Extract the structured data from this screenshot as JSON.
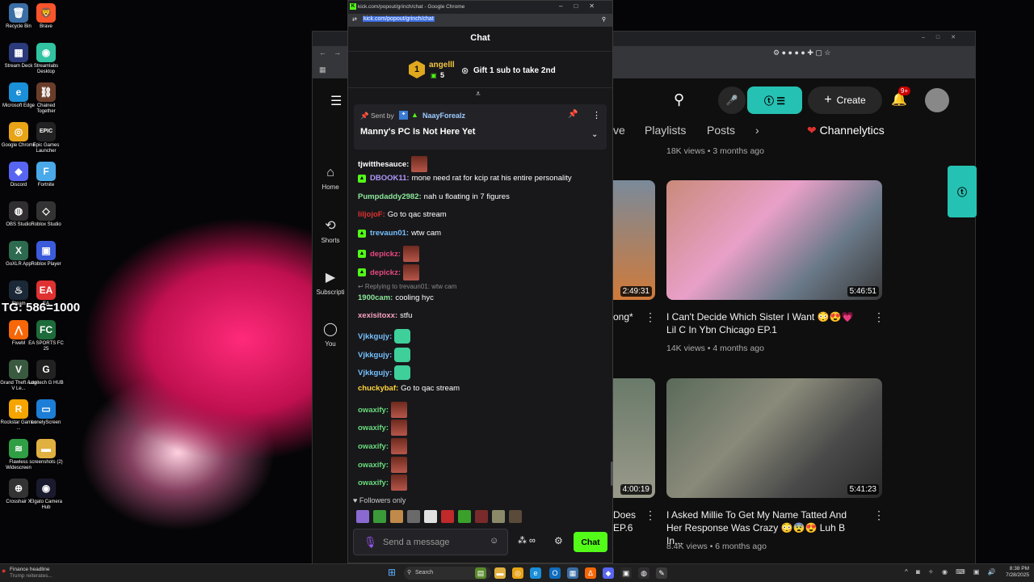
{
  "desktop": {
    "icons": [
      {
        "label": "Recycle Bin",
        "glyph": "🗑",
        "color": "#3a6ea5"
      },
      {
        "label": "Brave",
        "glyph": "🦁",
        "color": "#fb542b"
      },
      {
        "label": "Stream Deck",
        "glyph": "▦",
        "color": "#2b3a7a"
      },
      {
        "label": "Streamlabs Desktop",
        "glyph": "◉",
        "color": "#31c3a2"
      },
      {
        "label": "Microsoft Edge",
        "glyph": "e",
        "color": "#1b8fd8"
      },
      {
        "label": "Chained Together",
        "glyph": "⛓",
        "color": "#6a3d2a"
      },
      {
        "label": "Google Chrome",
        "glyph": "◎",
        "color": "#e8a317"
      },
      {
        "label": "Epic Games Launcher",
        "glyph": "EPIC",
        "color": "#222222"
      },
      {
        "label": "Discord",
        "glyph": "◆",
        "color": "#5865f2"
      },
      {
        "label": "Fortnite",
        "glyph": "F",
        "color": "#4aa9e8"
      },
      {
        "label": "OBS Studio",
        "glyph": "◍",
        "color": "#302e31"
      },
      {
        "label": "Roblox Studio",
        "glyph": "◇",
        "color": "#333333"
      },
      {
        "label": "GoXLR App",
        "glyph": "X",
        "color": "#2d6a4f"
      },
      {
        "label": "Roblox Player",
        "glyph": "▣",
        "color": "#3b5bdb"
      },
      {
        "label": "Steam",
        "glyph": "♨",
        "color": "#1b2838"
      },
      {
        "label": "EA",
        "glyph": "EA",
        "color": "#e03131"
      },
      {
        "label": "FiveM",
        "glyph": "⋀",
        "color": "#f76707"
      },
      {
        "label": "EA SPORTS FC 25",
        "glyph": "FC",
        "color": "#1d6b3a"
      },
      {
        "label": "Grand Theft Auto V Le...",
        "glyph": "V",
        "color": "#3a5a40"
      },
      {
        "label": "Logitech G HUB",
        "glyph": "G",
        "color": "#222222"
      },
      {
        "label": "Rockstar Games ...",
        "glyph": "R",
        "color": "#f5a400"
      },
      {
        "label": "LonelyScreen",
        "glyph": "▭",
        "color": "#1c7ed6"
      },
      {
        "label": "Flawless Widescreen",
        "glyph": "≋",
        "color": "#2f9e44"
      },
      {
        "label": "screenshots (2)",
        "glyph": "▬",
        "color": "#e0b040"
      },
      {
        "label": "Crosshair X",
        "glyph": "⊕",
        "color": "#333333"
      },
      {
        "label": "Elgato Camera Hub",
        "glyph": "◉",
        "color": "#1a1a2e"
      }
    ],
    "overlay_text": "TG: 586=1000"
  },
  "youtube_window": {
    "sidebar": [
      {
        "label": "Home",
        "glyph": "⌂"
      },
      {
        "label": "Shorts",
        "glyph": "⟲"
      },
      {
        "label": "Subscripti",
        "glyph": "▶"
      },
      {
        "label": "You",
        "glyph": "◯"
      }
    ],
    "create_label": "Create",
    "notif_count": "9+",
    "tabs": [
      "ve",
      "Playlists",
      "Posts",
      "›",
      "Channelytics"
    ],
    "top_meta": "18K views • 3 months ago",
    "videos": [
      {
        "title": "I Can't Decide Which Sister I Want 😳😍💗 Lil C In Ybn Chicago EP.1",
        "meta": "14K views • 4 months ago",
        "duration": "5:46:51"
      },
      {
        "title": "I Asked Millie To Get My Name Tatted And Her Response Was Crazy 😳😨😍 Luh B In...",
        "meta": "8.4K views • 6 months ago",
        "duration": "5:41:23"
      }
    ],
    "left_partial": [
      {
        "duration": "2:49:31",
        "title": "ong*"
      },
      {
        "duration": "4:00:19",
        "title": "Does EP.6"
      }
    ]
  },
  "kick": {
    "window_title": "kick.com/popout/grinch/chat - Google Chrome",
    "url": "kick.com/popout/grinch/chat",
    "chat_title": "Chat",
    "gift": {
      "rank": "1",
      "user": "angelll",
      "count": "5",
      "cta": "Gift 1 sub to take 2nd"
    },
    "pinned": {
      "sent_by": "Sent by",
      "user": "NaayForealz",
      "message": "Manny's PC Is Not Here Yet"
    },
    "messages": [
      {
        "user": "tjwitthesauce:",
        "color": "#ffffff",
        "text": "",
        "emote": "face",
        "badge": false
      },
      {
        "user": "DBOOK11:",
        "color": "#b197fc",
        "text": "mone need rat for kcip rat his entire personality",
        "emote": "",
        "badge": true
      },
      {
        "user": "Pumpdaddy2982:",
        "color": "#8ce99a",
        "text": "nah u floating in 7 figures",
        "emote": "",
        "badge": false
      },
      {
        "user": "liljojoF:",
        "color": "#e03131",
        "text": "Go to qac stream",
        "emote": "",
        "badge": false
      },
      {
        "user": "trevaun01:",
        "color": "#74c0fc",
        "text": "wtw cam",
        "emote": "",
        "badge": true
      },
      {
        "user": "depickz:",
        "color": "#e64980",
        "text": "",
        "emote": "face",
        "badge": true
      },
      {
        "user": "depickz:",
        "color": "#e64980",
        "text": "",
        "emote": "face",
        "badge": true
      },
      {
        "user": "1900cam:",
        "color": "#8ce99a",
        "text": "cooling hyc",
        "emote": "",
        "badge": false
      },
      {
        "user": "xexisitoxx:",
        "color": "#faa2c1",
        "text": "stfu",
        "emote": "",
        "badge": false
      },
      {
        "user": "Vjkkgujy:",
        "color": "#74c0fc",
        "text": "",
        "emote": "green",
        "badge": false
      },
      {
        "user": "Vjkkgujy:",
        "color": "#74c0fc",
        "text": "",
        "emote": "green",
        "badge": false
      },
      {
        "user": "Vjkkgujy:",
        "color": "#74c0fc",
        "text": "",
        "emote": "green",
        "badge": false
      },
      {
        "user": "chuckybaf:",
        "color": "#ffd43b",
        "text": "Go to qac stream",
        "emote": "",
        "badge": false
      },
      {
        "user": "owaxify:",
        "color": "#69db7c",
        "text": "",
        "emote": "face",
        "badge": false
      },
      {
        "user": "owaxify:",
        "color": "#69db7c",
        "text": "",
        "emote": "face",
        "badge": false
      },
      {
        "user": "owaxify:",
        "color": "#69db7c",
        "text": "",
        "emote": "face",
        "badge": false
      },
      {
        "user": "owaxify:",
        "color": "#69db7c",
        "text": "",
        "emote": "face",
        "badge": false
      },
      {
        "user": "owaxify:",
        "color": "#69db7c",
        "text": "",
        "emote": "face",
        "badge": false
      }
    ],
    "reply_text": "Replying to trevaun01: wtw cam",
    "followers_only": "Followers only",
    "input_placeholder": "Send a message",
    "chat_button": "Chat",
    "accent": "#53fc18"
  },
  "taskbar": {
    "finance_title": "Finance headline",
    "finance_sub": "Trump reiterates...",
    "search_label": "Search",
    "clock_time": "8:38 PM",
    "clock_date": "7/28/2025"
  }
}
